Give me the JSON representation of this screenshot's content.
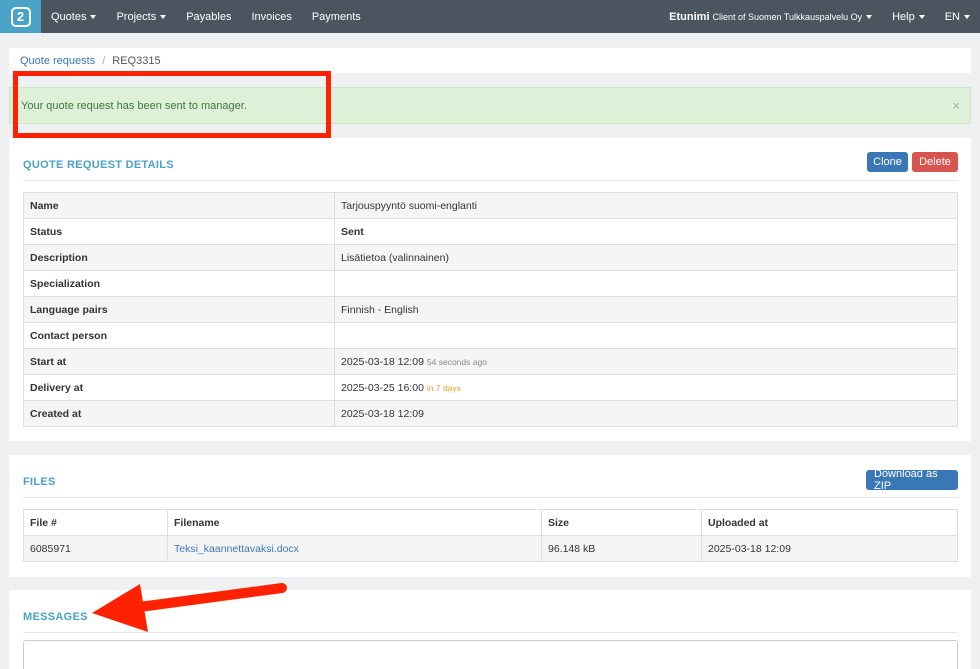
{
  "nav": {
    "logo_glyph": "2",
    "items": [
      {
        "label": "Quotes",
        "dropdown": true
      },
      {
        "label": "Projects",
        "dropdown": true
      },
      {
        "label": "Payables",
        "dropdown": false
      },
      {
        "label": "Invoices",
        "dropdown": false
      },
      {
        "label": "Payments",
        "dropdown": false
      }
    ],
    "user_name": "Etunimi",
    "user_sub": "Client of Suomen Tulkkauspalvelu Oy",
    "help": "Help",
    "lang": "EN"
  },
  "breadcrumb": {
    "parent": "Quote requests",
    "separator": "/",
    "current": "REQ3315"
  },
  "alert": {
    "message": "Your quote request has been sent to manager.",
    "close": "×"
  },
  "details": {
    "title": "QUOTE REQUEST DETAILS",
    "clone_label": "Clone",
    "delete_label": "Delete",
    "rows": [
      {
        "label": "Name",
        "value": "Tarjouspyyntö suomi-englanti"
      },
      {
        "label": "Status",
        "value": "Sent"
      },
      {
        "label": "Description",
        "value": "Lisätietoa (valinnainen)"
      },
      {
        "label": "Specialization",
        "value": ""
      },
      {
        "label": "Language pairs",
        "value": "Finnish - English"
      },
      {
        "label": "Contact person",
        "value": ""
      },
      {
        "label": "Start at",
        "value": "2025-03-18 12:09",
        "note": "54 seconds ago"
      },
      {
        "label": "Delivery at",
        "value": "2025-03-25 16:00",
        "note": "in 7 days"
      },
      {
        "label": "Created at",
        "value": "2025-03-18 12:09"
      }
    ]
  },
  "files": {
    "title": "FILES",
    "download_label": "Download as ZIP",
    "headers": [
      "File #",
      "Filename",
      "Size",
      "Uploaded at"
    ],
    "rows": [
      {
        "id": "6085971",
        "filename": "Teksi_kaannettavaksi.docx",
        "size": "96.148 kB",
        "uploaded": "2025-03-18 12:09"
      }
    ]
  },
  "messages": {
    "title": "MESSAGES"
  },
  "colors": {
    "navbar": "#4a5560",
    "accent": "#4aa3c6",
    "primary": "#3a78b5",
    "danger": "#d9534f",
    "success_bg": "#dff0d8",
    "annotation": "#ff2200"
  }
}
